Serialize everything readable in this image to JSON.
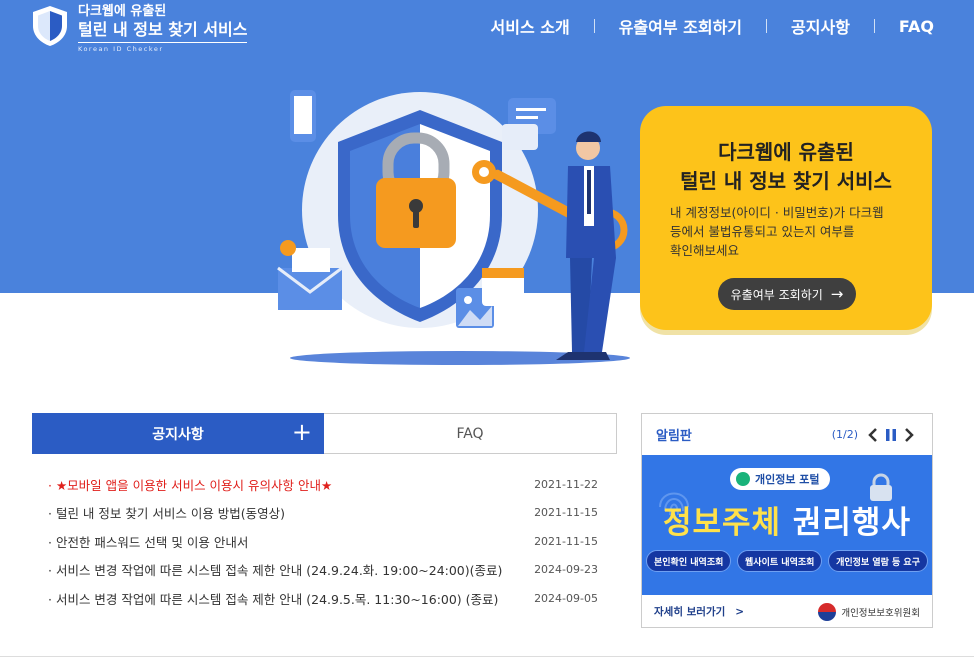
{
  "header": {
    "logo_line1": "다크웹에 유출된",
    "logo_line2": "털린 내 정보 찾기 서비스",
    "logo_sub": "Korean ID Checker",
    "nav": [
      "서비스 소개",
      "유출여부 조회하기",
      "공지사항",
      "FAQ"
    ]
  },
  "hero": {
    "title_line1": "다크웹에 유출된",
    "title_line2": "털린 내 정보 찾기 서비스",
    "desc_line1": "내 계정정보(아이디 · 비밀번호)가 다크웹",
    "desc_line2": "등에서 불법유통되고 있는지 여부를",
    "desc_line3": "확인해보세요",
    "button": "유출여부 조회하기"
  },
  "tabs": {
    "notice": "공지사항",
    "faq": "FAQ",
    "plus": "+"
  },
  "notices": [
    {
      "title": "· ★모바일 앱을 이용한 서비스 이용시 유의사항 안내★",
      "date": "2021-11-22"
    },
    {
      "title": "· 털린 내 정보 찾기 서비스 이용 방법(동영상)",
      "date": "2021-11-15"
    },
    {
      "title": "· 안전한 패스워드 선택 및 이용 안내서",
      "date": "2021-11-15"
    },
    {
      "title": "· 서비스 변경 작업에 따른 시스템 접속 제한 안내 (24.9.24.화. 19:00~24:00)(종료)",
      "date": "2024-09-23"
    },
    {
      "title": "· 서비스 변경 작업에 따른 시스템 접속 제한 안내 (24.9.5.목. 11:30~16:00) (종료)",
      "date": "2024-09-05"
    }
  ],
  "board": {
    "title": "알림판",
    "page": "(1/2)",
    "portal": "개인정보 포털",
    "headline_a": "정보주체",
    "headline_b": "권리행사",
    "pills": [
      "본인확인 내역조회",
      "웹사이트 내역조회",
      "개인정보 열람 등 요구"
    ],
    "more": "자세히 보러가기",
    "agency": "개인정보보호위원회"
  },
  "colors": {
    "primary": "#2b5cc4",
    "hero_bg": "#4a82dc",
    "card": "#fdc31a",
    "alert": "#e0201c"
  }
}
